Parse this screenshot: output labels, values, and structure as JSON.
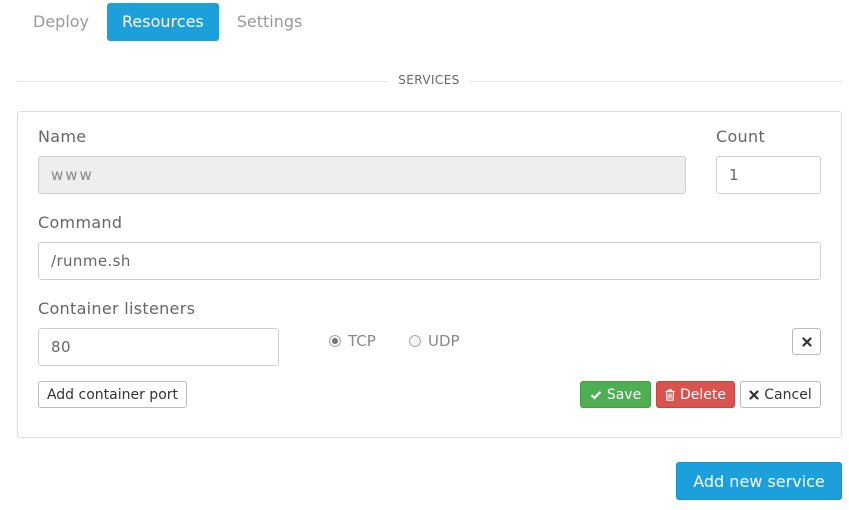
{
  "tabs": [
    {
      "label": "Deploy",
      "active": false
    },
    {
      "label": "Resources",
      "active": true
    },
    {
      "label": "Settings",
      "active": false
    }
  ],
  "section_title": "SERVICES",
  "service": {
    "name_label": "Name",
    "name_value": "www",
    "count_label": "Count",
    "count_value": "1",
    "command_label": "Command",
    "command_value": "/runme.sh",
    "listeners_label": "Container listeners",
    "port_value": "80",
    "protocol_options": [
      {
        "label": "TCP",
        "selected": true
      },
      {
        "label": "UDP",
        "selected": false
      }
    ],
    "selected_protocol": "TCP",
    "remove_listener_icon": "close-icon",
    "add_port_label": "Add container port",
    "save_label": "Save",
    "delete_label": "Delete",
    "cancel_label": "Cancel",
    "save_icon": "check-icon",
    "delete_icon": "trash-icon",
    "cancel_icon": "x-icon"
  },
  "add_service_label": "Add new service",
  "colors": {
    "accent": "#1ba0db",
    "save": "#4fae52",
    "delete": "#d9534f"
  }
}
